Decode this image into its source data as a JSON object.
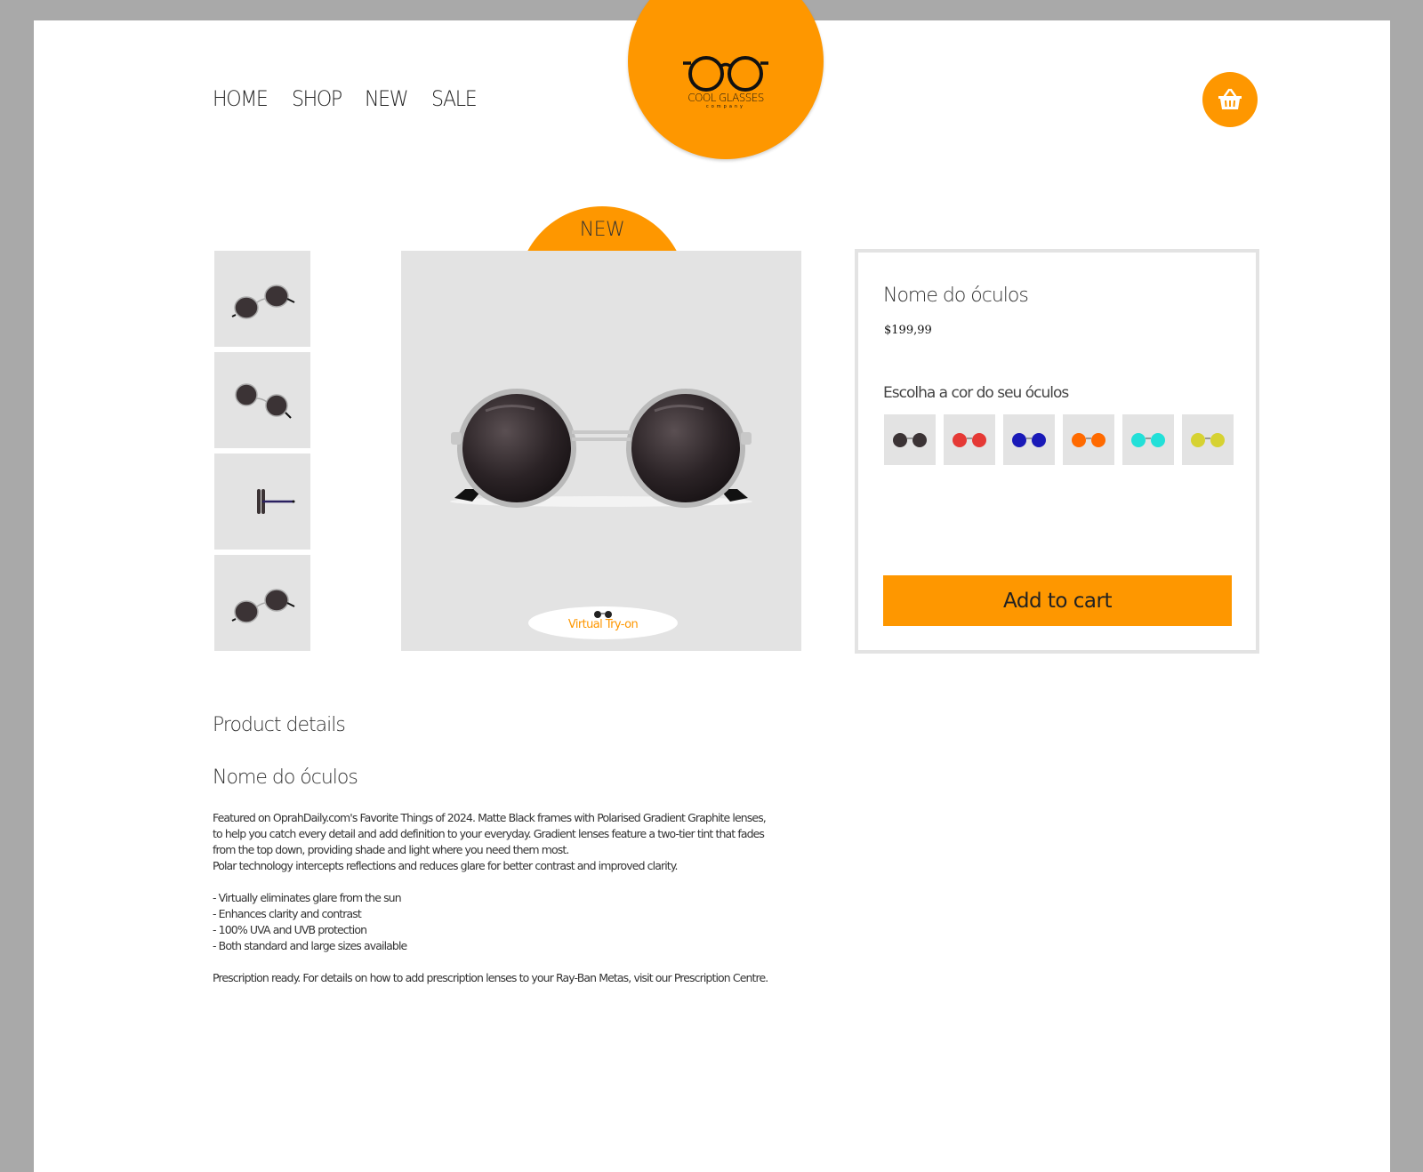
{
  "nav": {
    "items": [
      "HOME",
      "SHOP",
      "NEW",
      "SALE"
    ]
  },
  "logo": {
    "name": "COOL GLASSES",
    "sub": "company"
  },
  "cart": {
    "icon": "basket-icon"
  },
  "product": {
    "badge": "NEW",
    "title": "Nome do óculos",
    "price": "$199,99",
    "color_label": "Escolha a cor do seu óculos",
    "colors": [
      "#3b3335",
      "#e53935",
      "#1a1ab8",
      "#ff6a00",
      "#22e0d8",
      "#d6d232"
    ],
    "add_to_cart": "Add to cart",
    "virtual_tryon": "Virtual Try-on",
    "thumbnails": [
      "front-angle",
      "angle-left",
      "side",
      "front-angle"
    ]
  },
  "details": {
    "heading": "Product details",
    "name": "Nome do óculos",
    "lines": [
      "Featured on OprahDaily.com's Favorite Things of 2024. Matte Black frames with Polarised Gradient Graphite lenses,",
      "to help you catch every detail and add definition to your everyday. Gradient lenses feature a two-tier tint that fades",
      "from the top down, providing shade and light where you need them most.",
      "Polar technology intercepts reflections and reduces glare for better contrast and improved clarity."
    ],
    "bullets": [
      "- Virtually eliminates glare from the sun",
      "- Enhances clarity and contrast",
      "- 100% UVA and UVB protection",
      "- Both standard and large sizes available"
    ],
    "footer": "Prescription ready. For details on how to add prescription lenses to your Ray-Ban Metas, visit our Prescription Centre."
  }
}
